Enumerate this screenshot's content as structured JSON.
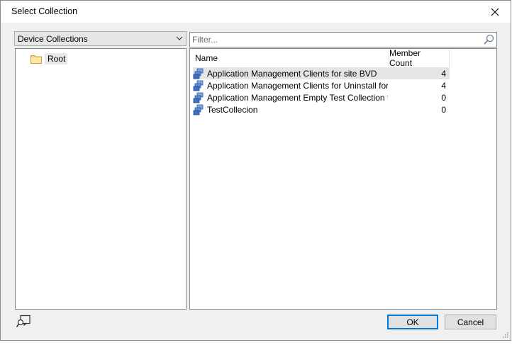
{
  "window": {
    "title": "Select Collection",
    "close_icon": "close-icon"
  },
  "left_panel": {
    "collection_type": "Device Collections",
    "tree": [
      {
        "label": "Root",
        "icon": "folder-icon"
      }
    ]
  },
  "right_panel": {
    "filter_placeholder": "Filter...",
    "columns": {
      "name": "Name",
      "member_count": "Member Count"
    },
    "rows": [
      {
        "name": "Application Management Clients for site BVD",
        "member_count": "4",
        "selected": true
      },
      {
        "name": "Application Management Clients for Uninstall for site ...",
        "member_count": "4",
        "selected": false
      },
      {
        "name": "Application Management Empty Test Collection for si...",
        "member_count": "0",
        "selected": false
      },
      {
        "name": "TestCollecion",
        "member_count": "0",
        "selected": false
      }
    ]
  },
  "buttons": {
    "ok": "OK",
    "cancel": "Cancel"
  },
  "colors": {
    "accent": "#0078d7",
    "selection": "#e5e5e5"
  }
}
